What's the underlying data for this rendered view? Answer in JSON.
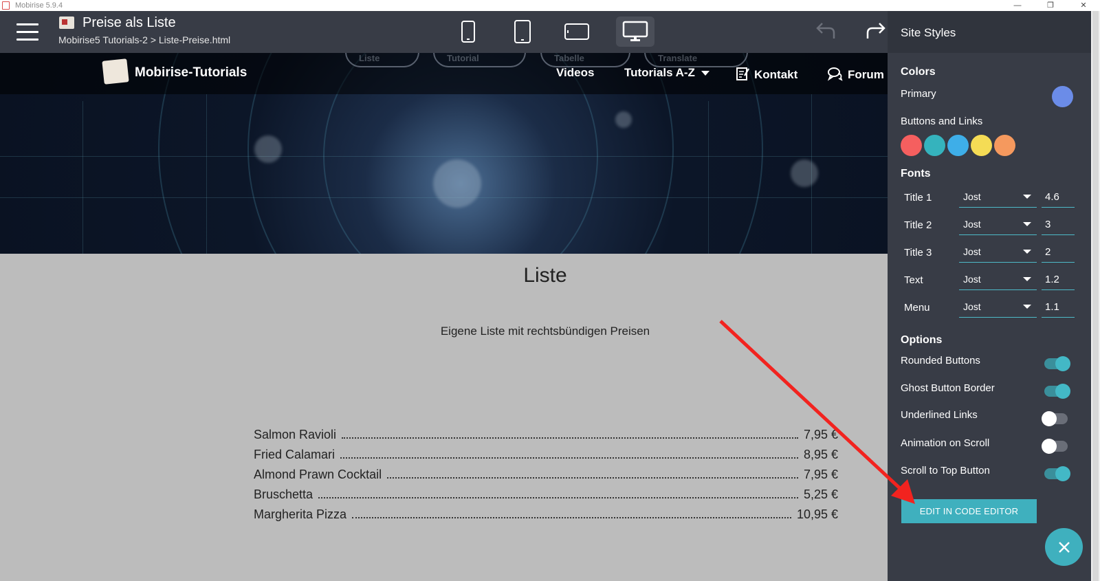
{
  "window": {
    "title": "Mobirise 5.9.4"
  },
  "topbar": {
    "page_title": "Preise als Liste",
    "page_path": "Mobirise5 Tutorials-2 > Liste-Preise.html"
  },
  "site": {
    "brand": "Mobirise-Tutorials",
    "menu": [
      "Videos",
      "Tutorials A-Z",
      "Kontakt",
      "Forum"
    ],
    "ghost_buttons": [
      "Liste",
      "Tutorial",
      "Tabelle",
      "Translate"
    ]
  },
  "content": {
    "title": "Liste",
    "subtitle": "Eigene Liste mit rechtsbündigen Preisen",
    "items": [
      {
        "name": "Salmon Ravioli",
        "price": "7,95 €"
      },
      {
        "name": "Fried Calamari",
        "price": "8,95 €"
      },
      {
        "name": "Almond Prawn Cocktail",
        "price": "7,95 €"
      },
      {
        "name": "Bruschetta",
        "price": "5,25 €"
      },
      {
        "name": "Margherita Pizza",
        "price": "10,95 €"
      }
    ]
  },
  "panel": {
    "title": "Site Styles",
    "colors_label": "Colors",
    "primary_label": "Primary",
    "primary_color": "#6b8ce8",
    "buttons_links_label": "Buttons and Links",
    "button_colors": [
      "#f55f5f",
      "#35b3bd",
      "#3eaee8",
      "#f5dc55",
      "#f5995e"
    ],
    "fonts_label": "Fonts",
    "fonts": [
      {
        "name": "Title 1",
        "family": "Jost",
        "size": "4.6"
      },
      {
        "name": "Title 2",
        "family": "Jost",
        "size": "3"
      },
      {
        "name": "Title 3",
        "family": "Jost",
        "size": "2"
      },
      {
        "name": "Text",
        "family": "Jost",
        "size": "1.2"
      },
      {
        "name": "Menu",
        "family": "Jost",
        "size": "1.1"
      }
    ],
    "options_label": "Options",
    "options": [
      {
        "label": "Rounded Buttons",
        "on": true
      },
      {
        "label": "Ghost Button Border",
        "on": true
      },
      {
        "label": "Underlined Links",
        "on": false
      },
      {
        "label": "Animation on Scroll",
        "on": false
      },
      {
        "label": "Scroll to Top Button",
        "on": true
      }
    ],
    "code_editor_button": "EDIT IN CODE EDITOR",
    "accent_color": "#3fb0be"
  },
  "annotation": {
    "arrow_color": "#f2231f"
  }
}
